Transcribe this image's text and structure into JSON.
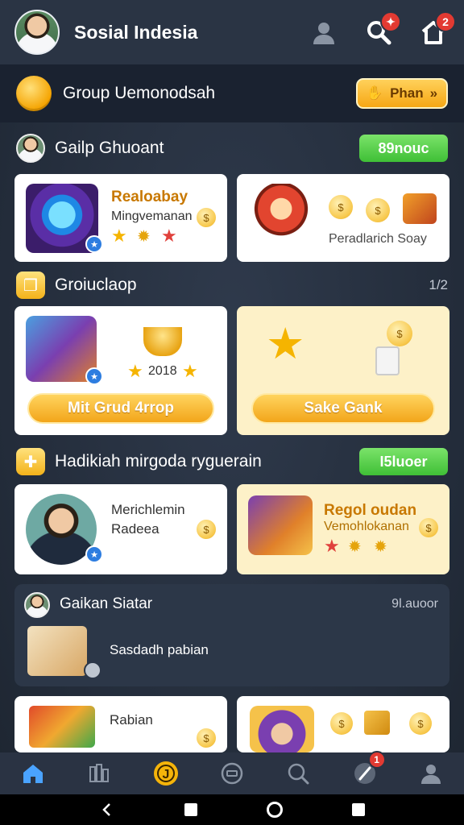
{
  "header": {
    "app_title": "Sosial Indesia",
    "notif_badge": "2",
    "search_badge": "✦"
  },
  "group_bar": {
    "title": "Group Uemonodsah",
    "plan_label": "Phan"
  },
  "section1": {
    "title": "Gailp Ghuoant",
    "button": "89nouc",
    "card1": {
      "title": "Realoabay",
      "subtitle": "Mingvemanan"
    },
    "card2": {
      "caption": "Peradlarich Soay"
    }
  },
  "section2": {
    "title": "Groiuclaop",
    "page_indicator": "1/2",
    "card1": {
      "year": "2018",
      "button": "Mit Grud 4rrop"
    },
    "card2": {
      "button": "Sake Gank"
    }
  },
  "section3": {
    "title": "Hadikiah mirgoda ryguerain",
    "button": "I5luoer",
    "card1": {
      "name_line1": "Merichlemin",
      "name_line2": "Radeea"
    },
    "card2": {
      "title": "Regol oudan",
      "subtitle": "Vemohlokanan"
    }
  },
  "panel": {
    "title": "Gaikan Siatar",
    "meta": "9l.auoor",
    "text": "Sasdadh pabian"
  },
  "section4": {
    "card1": {
      "title": "Rabian"
    }
  },
  "colors": {
    "accent_orange": "#f6a715",
    "accent_green": "#3fbf36",
    "header_bg": "#2a3444",
    "badge_red": "#e23a32"
  },
  "icons": {
    "nav": [
      "home-icon",
      "grid-icon",
      "coin-icon",
      "chat-icon",
      "search-icon",
      "pen-icon",
      "profile-icon"
    ],
    "nav_badge": "1"
  }
}
